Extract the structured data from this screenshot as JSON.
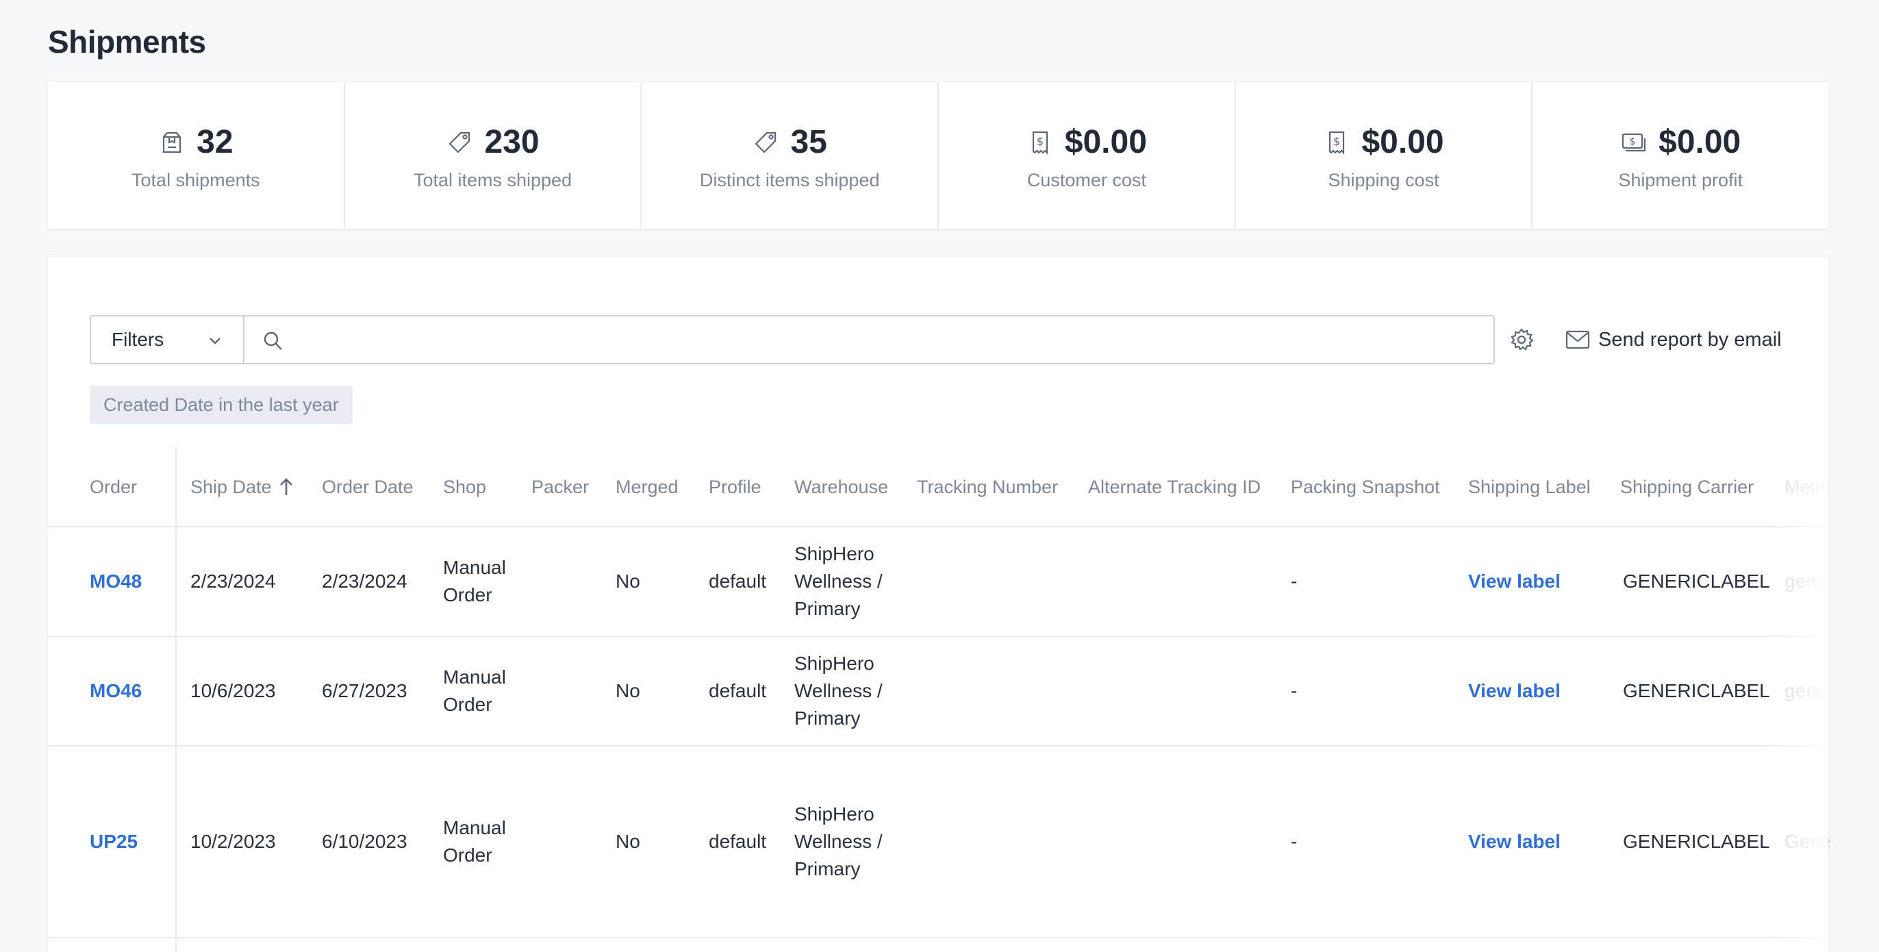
{
  "page": {
    "title": "Shipments"
  },
  "stats": [
    {
      "icon": "package-icon",
      "value": "32",
      "label": "Total shipments"
    },
    {
      "icon": "tag-icon",
      "value": "230",
      "label": "Total items shipped"
    },
    {
      "icon": "tag-icon",
      "value": "35",
      "label": "Distinct items shipped"
    },
    {
      "icon": "receipt-dollar-icon",
      "value": "$0.00",
      "label": "Customer cost"
    },
    {
      "icon": "receipt-dollar-icon",
      "value": "$0.00",
      "label": "Shipping cost"
    },
    {
      "icon": "cash-icon",
      "value": "$0.00",
      "label": "Shipment profit"
    }
  ],
  "toolbar": {
    "filters_label": "Filters",
    "search_placeholder": "",
    "search_value": "",
    "email_label": "Send report by email"
  },
  "active_filter": "Created Date in the last year",
  "table": {
    "columns": [
      "Order",
      "Ship Date",
      "Order Date",
      "Shop",
      "Packer",
      "Merged",
      "Profile",
      "Warehouse",
      "Tracking Number",
      "Alternate Tracking ID",
      "Packing Snapshot",
      "Shipping Label",
      "Shipping Carrier",
      "Meth"
    ],
    "sorted_column": "Ship Date",
    "sort_direction": "ascending",
    "rows": [
      {
        "order": "MO48",
        "ship_date": "2/23/2024",
        "order_date": "2/23/2024",
        "shop": [
          "Manual",
          "Order"
        ],
        "packer": "",
        "merged": "No",
        "profile": "default",
        "warehouse": [
          "ShipHero",
          "Wellness /",
          "Primary"
        ],
        "tracking_number": "",
        "alternate_tracking_id": "",
        "packing_snapshot": "-",
        "shipping_label": "View label",
        "shipping_carrier": "GENERICLABEL",
        "method": "gene"
      },
      {
        "order": "MO46",
        "ship_date": "10/6/2023",
        "order_date": "6/27/2023",
        "shop": [
          "Manual",
          "Order"
        ],
        "packer": "",
        "merged": "No",
        "profile": "default",
        "warehouse": [
          "ShipHero",
          "Wellness /",
          "Primary"
        ],
        "tracking_number": "",
        "alternate_tracking_id": "",
        "packing_snapshot": "-",
        "shipping_label": "View label",
        "shipping_carrier": "GENERICLABEL",
        "method": "gene"
      },
      {
        "order": "UP25",
        "ship_date": "10/2/2023",
        "order_date": "6/10/2023",
        "shop": [
          "Manual",
          "Order"
        ],
        "packer": "",
        "merged": "No",
        "profile": "default",
        "warehouse": [
          "ShipHero",
          "Wellness /",
          "Primary"
        ],
        "tracking_number": "",
        "alternate_tracking_id": "",
        "packing_snapshot": "-",
        "shipping_label": "View label",
        "shipping_carrier": "GENERICLABEL",
        "method": "Gene"
      }
    ]
  }
}
